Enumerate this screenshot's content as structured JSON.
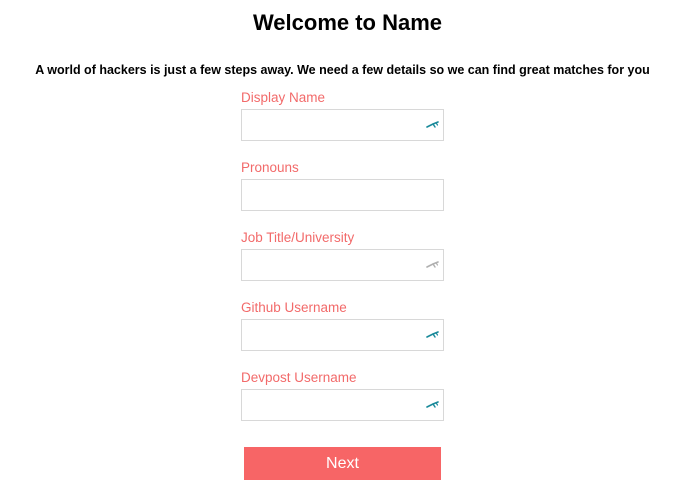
{
  "header": {
    "title": "Welcome to Name",
    "subtitle": "A world of hackers is just a few steps away. We need a few details so we can find great matches for you"
  },
  "form": {
    "fields": [
      {
        "label": "Display Name",
        "value": "",
        "icon": "password-manager-key-icon"
      },
      {
        "label": "Pronouns",
        "value": "",
        "icon": ""
      },
      {
        "label": "Job Title/University",
        "value": "",
        "icon": "password-manager-key-icon"
      },
      {
        "label": "Github Username",
        "value": "",
        "icon": "password-manager-key-icon"
      },
      {
        "label": "Devpost Username",
        "value": "",
        "icon": "password-manager-key-icon"
      }
    ],
    "next_label": "Next"
  },
  "colors": {
    "label": "#f26a6a",
    "button": "#f76566",
    "icon_active": "#1a8a9a",
    "icon_muted": "#b0b0b0"
  }
}
